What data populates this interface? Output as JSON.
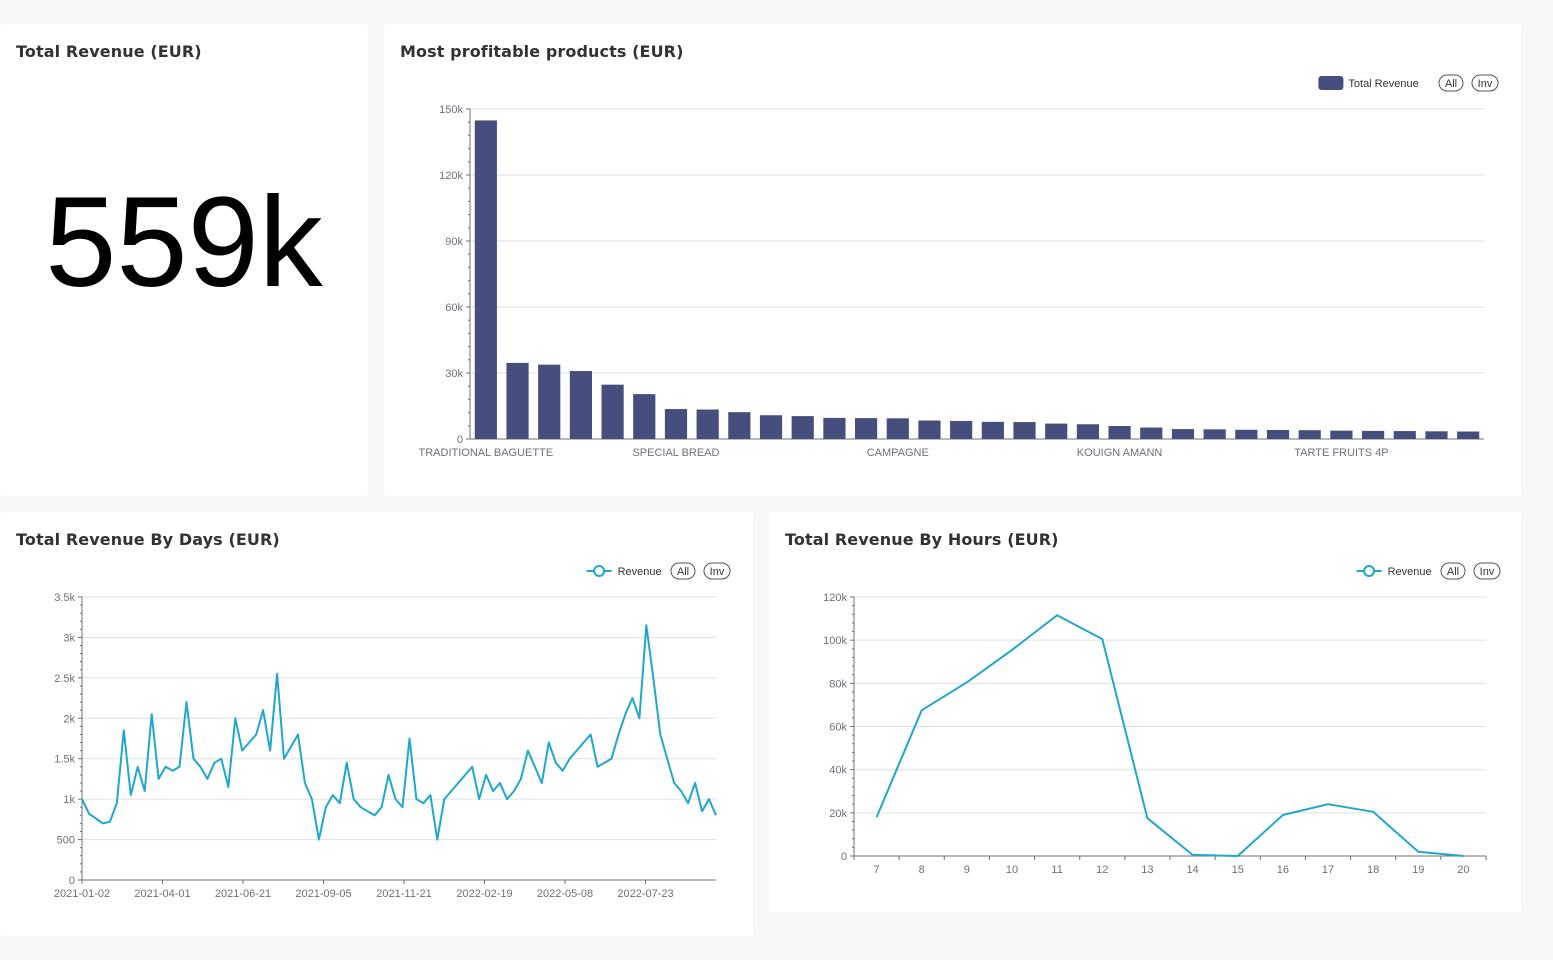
{
  "kpi": {
    "title": "Total Revenue (EUR)",
    "value": "559k"
  },
  "legend_controls": {
    "all": "All",
    "inv": "Inv"
  },
  "colors": {
    "bar": "#454e7c",
    "line": "#1fa8c9",
    "grid": "#e0e0e0",
    "axis": "#6e7079"
  },
  "products_chart": {
    "title": "Most profitable products (EUR)",
    "chart_data": {
      "type": "bar",
      "series": [
        {
          "name": "Total Revenue",
          "values": [
            144800,
            34600,
            33800,
            30900,
            24700,
            20400,
            13600,
            13400,
            12200,
            10800,
            10400,
            9600,
            9500,
            9400,
            8400,
            8200,
            7800,
            7700,
            7000,
            6700,
            5900,
            5200,
            4500,
            4400,
            4200,
            4100,
            4000,
            3800,
            3700,
            3600,
            3500,
            3400
          ]
        }
      ],
      "visible_category_labels": [
        "TRADITIONAL BAGUETTE",
        "SPECIAL BREAD",
        "CAMPAGNE",
        "KOUIGN AMANN",
        "TARTE FRUITS 4P"
      ],
      "label_indices": [
        0,
        6,
        13,
        20,
        27
      ],
      "ylim": [
        0,
        150000
      ],
      "yticks": [
        0,
        30000,
        60000,
        90000,
        120000,
        150000
      ],
      "ytick_labels": [
        "0",
        "30k",
        "60k",
        "90k",
        "120k",
        "150k"
      ],
      "grid": true,
      "legend_position": "top-right"
    }
  },
  "days_chart": {
    "title": "Total Revenue By Days (EUR)",
    "chart_data": {
      "type": "line",
      "series": [
        {
          "name": "Revenue",
          "x": [
            "2021-01-02",
            "2021-01-09",
            "2021-01-16",
            "2021-01-23",
            "2021-01-30",
            "2021-02-06",
            "2021-02-13",
            "2021-02-20",
            "2021-02-27",
            "2021-03-06",
            "2021-03-13",
            "2021-03-20",
            "2021-03-27",
            "2021-04-03",
            "2021-04-10",
            "2021-04-17",
            "2021-04-24",
            "2021-05-01",
            "2021-05-08",
            "2021-05-15",
            "2021-05-22",
            "2021-05-29",
            "2021-06-05",
            "2021-06-12",
            "2021-06-19",
            "2021-06-26",
            "2021-07-03",
            "2021-07-10",
            "2021-07-17",
            "2021-07-24",
            "2021-07-31",
            "2021-08-07",
            "2021-08-14",
            "2021-08-21",
            "2021-08-28",
            "2021-09-04",
            "2021-09-11",
            "2021-09-18",
            "2021-09-25",
            "2021-10-02",
            "2021-10-09",
            "2021-10-16",
            "2021-10-23",
            "2021-10-30",
            "2021-11-06",
            "2021-11-13",
            "2021-11-20",
            "2021-11-27",
            "2021-12-04",
            "2021-12-11",
            "2021-12-18",
            "2021-12-25",
            "2022-01-01",
            "2022-01-08",
            "2022-01-15",
            "2022-01-22",
            "2022-01-29",
            "2022-02-05",
            "2022-02-12",
            "2022-02-19",
            "2022-02-26",
            "2022-03-05",
            "2022-03-12",
            "2022-03-19",
            "2022-03-26",
            "2022-04-02",
            "2022-04-09",
            "2022-04-16",
            "2022-04-23",
            "2022-04-30",
            "2022-05-07",
            "2022-05-14",
            "2022-05-21",
            "2022-05-28",
            "2022-06-04",
            "2022-06-11",
            "2022-06-18",
            "2022-06-25",
            "2022-07-02",
            "2022-07-09",
            "2022-07-16",
            "2022-07-23",
            "2022-07-30",
            "2022-08-06",
            "2022-08-13",
            "2022-08-20",
            "2022-08-27",
            "2022-09-03",
            "2022-09-10",
            "2022-09-17",
            "2022-09-24",
            "2022-09-30"
          ],
          "values": [
            1000,
            820,
            760,
            700,
            720,
            950,
            1850,
            1050,
            1400,
            1100,
            2050,
            1250,
            1400,
            1350,
            1400,
            2200,
            1500,
            1400,
            1250,
            1450,
            1500,
            1150,
            2000,
            1600,
            1700,
            1800,
            2100,
            1600,
            2550,
            1500,
            1650,
            1800,
            1200,
            1000,
            500,
            900,
            1050,
            950,
            1450,
            1000,
            900,
            850,
            800,
            900,
            1300,
            1000,
            900,
            1750,
            1000,
            950,
            1050,
            500,
            1000,
            1100,
            1200,
            1300,
            1400,
            1000,
            1300,
            1100,
            1200,
            1000,
            1100,
            1250,
            1600,
            1400,
            1200,
            1700,
            1450,
            1350,
            1500,
            1600,
            1700,
            1800,
            1400,
            1450,
            1500,
            1800,
            2050,
            2250,
            2000,
            3150,
            2500,
            1800,
            1500,
            1200,
            1100,
            950,
            1200,
            850,
            1000,
            800
          ]
        }
      ],
      "xtick_labels": [
        "2021-01-02",
        "2021-04-01",
        "2021-06-21",
        "2021-09-05",
        "2021-11-21",
        "2022-02-19",
        "2022-05-08",
        "2022-07-23"
      ],
      "ylim": [
        0,
        3500
      ],
      "ytick_labels": [
        "0",
        "500",
        "1k",
        "1.5k",
        "2k",
        "2.5k",
        "3k",
        "3.5k"
      ],
      "grid": true,
      "legend_position": "top-right"
    }
  },
  "hours_chart": {
    "title": "Total Revenue By Hours (EUR)",
    "chart_data": {
      "type": "line",
      "series": [
        {
          "name": "Revenue",
          "x": [
            7,
            8,
            9,
            10,
            11,
            12,
            13,
            14,
            15,
            16,
            17,
            18,
            19,
            20
          ],
          "values": [
            18000,
            67500,
            80500,
            95500,
            111500,
            100500,
            17500,
            500,
            0,
            19000,
            24000,
            20500,
            2000,
            0
          ]
        }
      ],
      "xtick_labels": [
        "7",
        "8",
        "9",
        "10",
        "11",
        "12",
        "13",
        "14",
        "15",
        "16",
        "17",
        "18",
        "19",
        "20"
      ],
      "ylim": [
        0,
        120000
      ],
      "ytick_labels": [
        "0",
        "20k",
        "40k",
        "60k",
        "80k",
        "100k",
        "120k"
      ],
      "grid": true,
      "legend_position": "top-right"
    }
  }
}
